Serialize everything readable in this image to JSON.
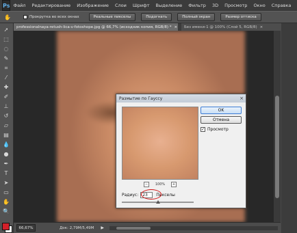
{
  "app": {
    "logo_text": "Ps",
    "menu": [
      "Файл",
      "Редактирование",
      "Изображение",
      "Слои",
      "Шрифт",
      "Выделение",
      "Фильтр",
      "3D",
      "Просмотр",
      "Окно",
      "Справка"
    ]
  },
  "options_bar": {
    "scroll_all_label": "Прокрутка во всех окнах",
    "buttons": [
      "Реальные пикселы",
      "Подогнать",
      "Полный экран",
      "Размер оттиска"
    ]
  },
  "tabs": [
    {
      "label": "professionalnaya-retush-lica-v-fotoshope.jpg @ 66,7% (исходник копия, RGB/8) *",
      "close": "×"
    },
    {
      "label": "Без имени-1 @ 100% (Слой 5, RGB/8)",
      "close": "×"
    }
  ],
  "status": {
    "zoom": "66,67%",
    "doc_info": "Док: 2,79M/5,49M",
    "arrow": "▶"
  },
  "colors": {
    "foreground": "#d2202a",
    "background": "#ffffff",
    "accent": "#d01010"
  },
  "dialog": {
    "title": "Размытие по Гауссу",
    "close": "×",
    "ok_label": "OK",
    "cancel_label": "Отмена",
    "preview_checkbox": {
      "label": "Просмотр",
      "checked": true,
      "mark": "✓"
    },
    "zoom_level": "100%",
    "zoom_out": "−",
    "zoom_in": "+",
    "radius_label": "Радиус:",
    "radius_value": "23",
    "radius_unit": "Пикселы",
    "radius_slider_fraction": 0.5
  }
}
